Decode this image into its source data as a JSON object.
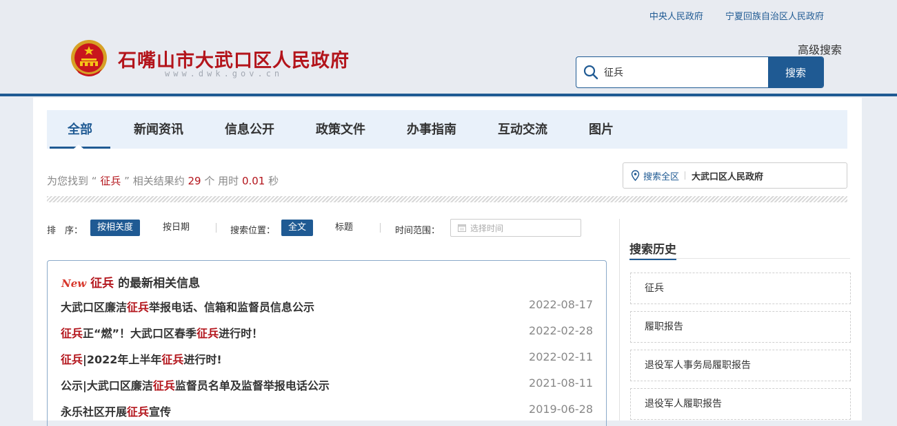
{
  "header": {
    "top_links": [
      "中央人民政府",
      "宁夏回族自治区人民政府"
    ],
    "site_title": "石嘴山市大武口区人民政府",
    "site_domain": "www.dwk.gov.cn",
    "advanced_search": "高级搜索",
    "search": {
      "value": "征兵",
      "button_label": "搜索"
    }
  },
  "tabs": [
    {
      "label": "全部",
      "active": true
    },
    {
      "label": "新闻资讯",
      "active": false
    },
    {
      "label": "信息公开",
      "active": false
    },
    {
      "label": "政策文件",
      "active": false
    },
    {
      "label": "办事指南",
      "active": false
    },
    {
      "label": "互动交流",
      "active": false
    },
    {
      "label": "图片",
      "active": false
    }
  ],
  "result_summary": {
    "prefix": "为您找到",
    "open_quote": "“",
    "keyword": "征兵",
    "close_quote": "”",
    "mid": "相关结果约",
    "count": "29",
    "unit": "个 用时",
    "time": "0.01",
    "time_unit": "秒"
  },
  "scope": {
    "all_label": "搜索全区",
    "site_label": "大武口区人民政府"
  },
  "filters": {
    "sort_label": "排　序：",
    "sort_options": [
      "按相关度",
      "按日期"
    ],
    "position_label": "搜索位置：",
    "position_options": [
      "全文",
      "标题"
    ],
    "time_label": "时间范围：",
    "time_placeholder": "选择时间"
  },
  "latest": {
    "new_tag": "New",
    "keyword": "征兵",
    "heading_suffix": "的最新相关信息",
    "items": [
      {
        "parts": [
          {
            "t": "大武口区廉洁"
          },
          {
            "t": "征兵",
            "hl": true
          },
          {
            "t": "举报电话、信箱和监督员信息公示"
          }
        ],
        "date": "2022-08-17"
      },
      {
        "parts": [
          {
            "t": "征兵",
            "hl": true
          },
          {
            "t": "正“燃”！大武口区春季"
          },
          {
            "t": "征兵",
            "hl": true
          },
          {
            "t": "进行时！"
          }
        ],
        "date": "2022-02-28"
      },
      {
        "parts": [
          {
            "t": "征兵",
            "hl": true
          },
          {
            "t": "|2022年上半年"
          },
          {
            "t": "征兵",
            "hl": true
          },
          {
            "t": "进行时!"
          }
        ],
        "date": "2022-02-11"
      },
      {
        "parts": [
          {
            "t": "公示|大武口区廉洁"
          },
          {
            "t": "征兵",
            "hl": true
          },
          {
            "t": "监督员名单及监督举报电话公示"
          }
        ],
        "date": "2021-08-11"
      },
      {
        "parts": [
          {
            "t": "永乐社区开展"
          },
          {
            "t": "征兵",
            "hl": true
          },
          {
            "t": "宣传"
          }
        ],
        "date": "2019-06-28"
      }
    ]
  },
  "history": {
    "title": "搜索历史",
    "items": [
      "征兵",
      "履职报告",
      "退役军人事务局履职报告",
      "退役军人履职报告"
    ]
  },
  "colors": {
    "brand_blue": "#1f5a93",
    "title_red": "#b3141b"
  },
  "icons": [
    "national-emblem-icon",
    "search-icon",
    "location-pin-icon",
    "calendar-icon"
  ]
}
